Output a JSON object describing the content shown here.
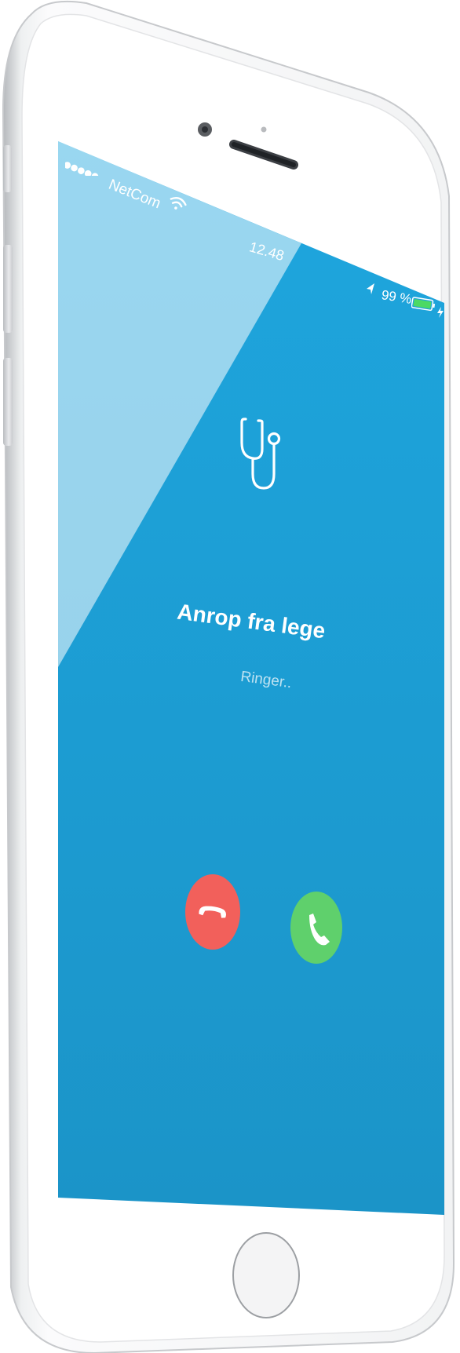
{
  "status_bar": {
    "carrier": "NetCom",
    "time": "12.48",
    "battery_percent": "99 %",
    "battery_level": 0.99,
    "signal_bars": 5
  },
  "call": {
    "icon": "stethoscope-icon",
    "title": "Anrop fra lege",
    "status": "Ringer.."
  },
  "actions": {
    "decline_icon": "phone-hangup-icon",
    "accept_icon": "phone-icon"
  },
  "colors": {
    "screen_blue": "#1ba3d9",
    "decline": "#f2605b",
    "accept": "#5fd06c",
    "battery_green": "#4cd964"
  }
}
